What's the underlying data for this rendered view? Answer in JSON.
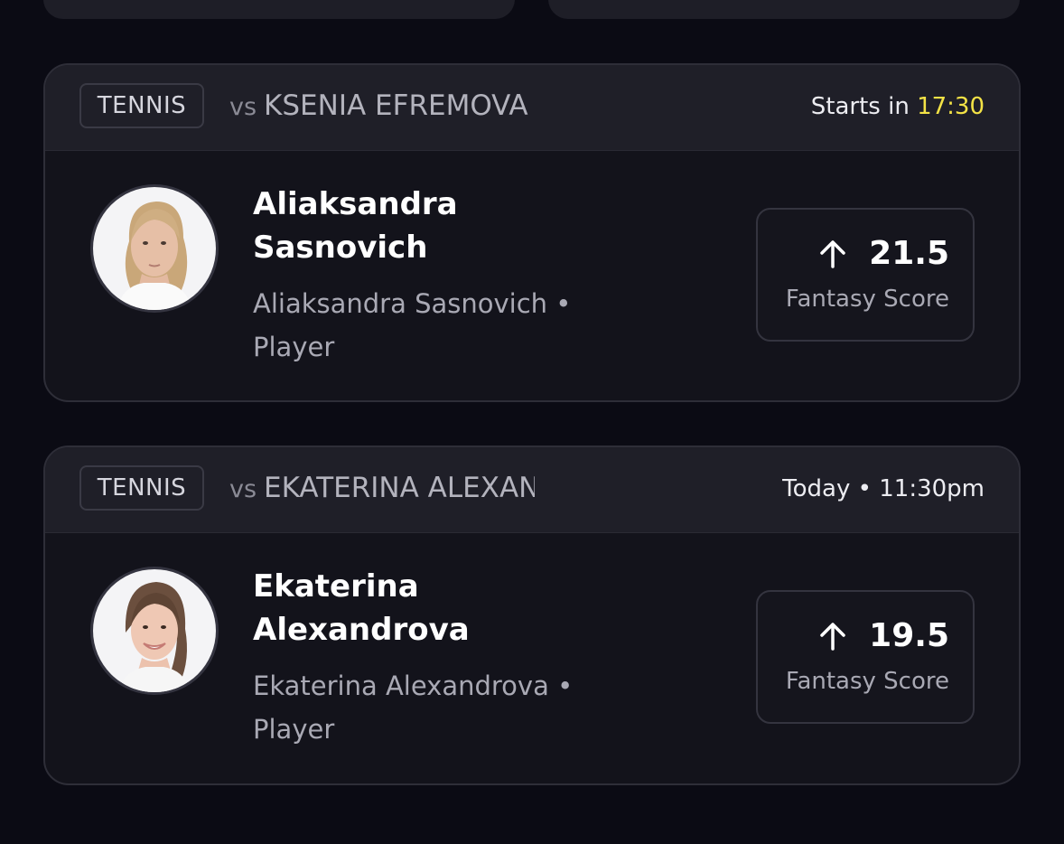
{
  "cards": [
    {
      "sport": "TENNIS",
      "vs": "vs",
      "opponent": "KSENIA EFREMOVA",
      "time_prefix": "Starts in",
      "countdown": "17:30",
      "time_text": "",
      "player_name_line1": "Aliaksandra",
      "player_name_line2": "Sasnovich",
      "player_sub_line1": "Aliaksandra Sasnovich •",
      "player_sub_line2": "Player",
      "score": "21.5",
      "score_label": "Fantasy Score",
      "arrow_icon": "arrow-up-icon",
      "countdown_color": "#f3e246"
    },
    {
      "sport": "TENNIS",
      "vs": "vs",
      "opponent": "EKATERINA ALEXANDROVA",
      "time_prefix": "",
      "countdown": "",
      "time_text": "Today • 11:30pm",
      "player_name_line1": "Ekaterina",
      "player_name_line2": "Alexandrova",
      "player_sub_line1": "Ekaterina Alexandrova •",
      "player_sub_line2": "Player",
      "score": "19.5",
      "score_label": "Fantasy Score",
      "arrow_icon": "arrow-up-icon"
    }
  ],
  "theme": {
    "background": "#0b0b14",
    "card_header": "#1f1f28",
    "card_body": "#13131b",
    "accent_yellow": "#f3e246"
  }
}
